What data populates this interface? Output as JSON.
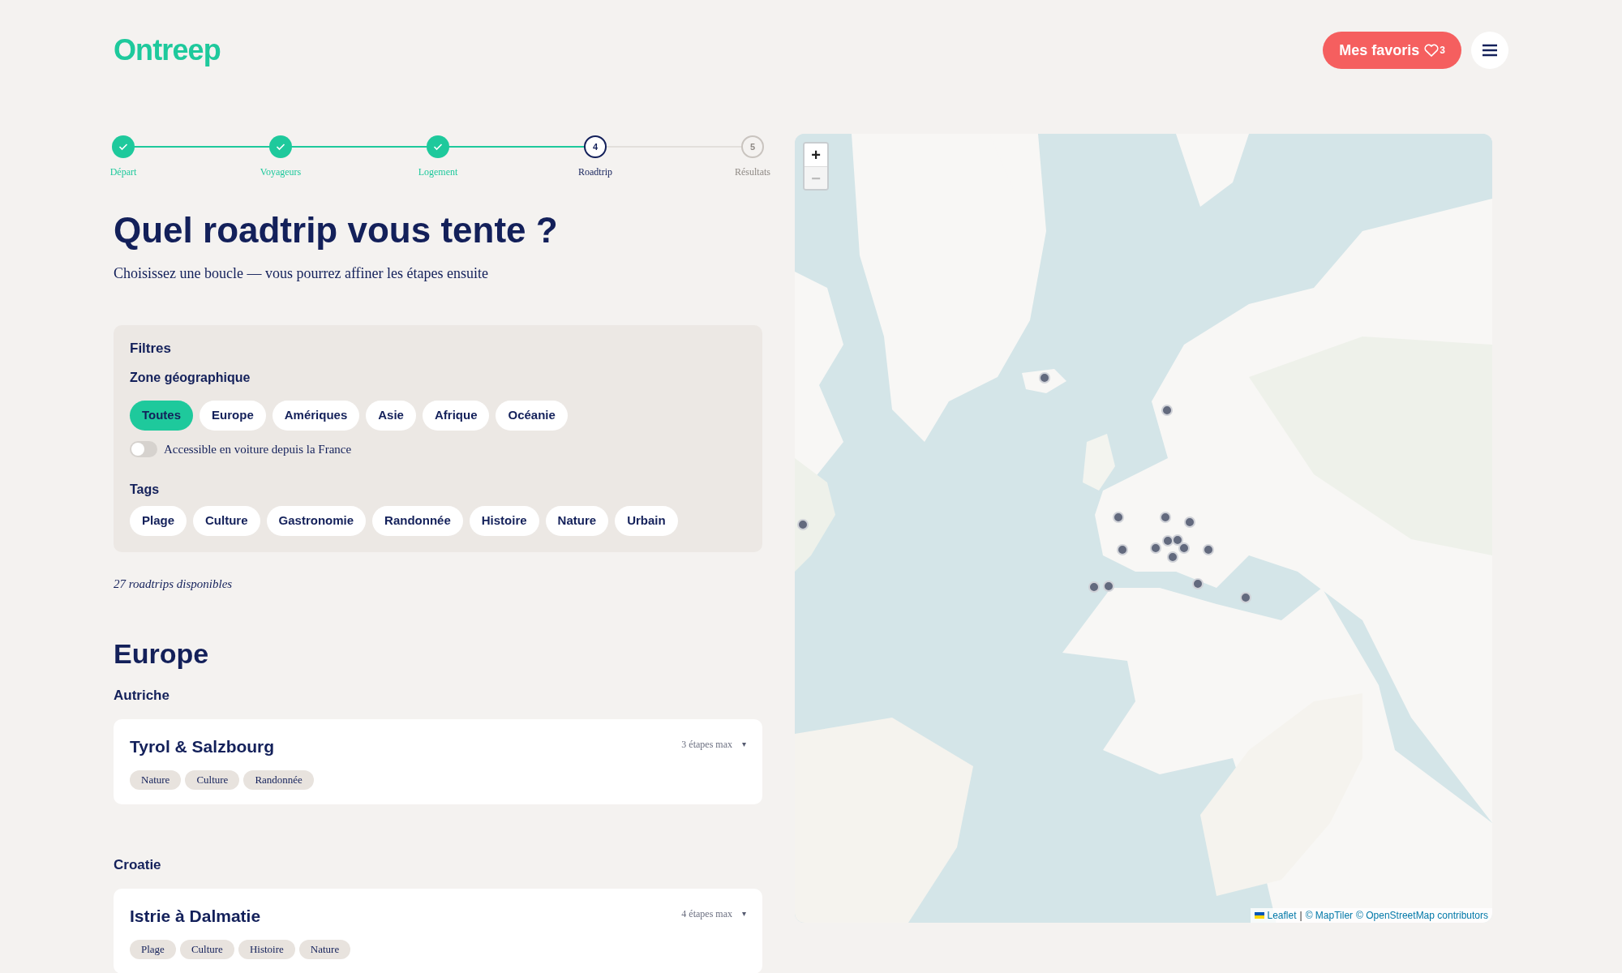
{
  "header": {
    "logo": "Ontreep",
    "favorites": {
      "label": "Mes favoris",
      "count": "3"
    }
  },
  "stepper": [
    {
      "label": "Départ",
      "completed": true,
      "selected": false
    },
    {
      "label": "Voyageurs",
      "completed": true,
      "selected": false
    },
    {
      "label": "Logement",
      "completed": true,
      "selected": false
    },
    {
      "label": "Roadtrip",
      "number": "4",
      "completed": false,
      "selected": true
    },
    {
      "label": "Résultats",
      "number": "5",
      "completed": false,
      "selected": false
    }
  ],
  "title": "Quel roadtrip vous tente ?",
  "subtitle": "Choisissez une boucle — vous pourrez affiner les étapes ensuite",
  "filters": {
    "title": "Filtres",
    "zone_label": "Zone géographique",
    "zones": [
      {
        "label": "Toutes",
        "selected": true
      },
      {
        "label": "Europe",
        "selected": false
      },
      {
        "label": "Amériques",
        "selected": false
      },
      {
        "label": "Asie",
        "selected": false
      },
      {
        "label": "Afrique",
        "selected": false
      },
      {
        "label": "Océanie",
        "selected": false
      }
    ],
    "car_toggle": {
      "label": "Accessible en voiture depuis la France",
      "on": false
    },
    "tags_label": "Tags",
    "tags": [
      {
        "label": "Plage",
        "selected": false
      },
      {
        "label": "Culture",
        "selected": false
      },
      {
        "label": "Gastronomie",
        "selected": false
      },
      {
        "label": "Randonnée",
        "selected": false
      },
      {
        "label": "Histoire",
        "selected": false
      },
      {
        "label": "Nature",
        "selected": false
      },
      {
        "label": "Urbain",
        "selected": false
      }
    ]
  },
  "count": "27 roadtrips disponibles",
  "sections": [
    {
      "title": "Europe",
      "countries": [
        {
          "name": "Autriche",
          "trips": [
            {
              "title": "Tyrol & Salzbourg",
              "stages": "3 étapes max",
              "caret": "▾",
              "tags": [
                "Nature",
                "Culture",
                "Randonnée"
              ]
            }
          ]
        },
        {
          "name": "Croatie",
          "trips": [
            {
              "title": "Istrie à Dalmatie",
              "stages": "4 étapes max",
              "caret": "▾",
              "tags": [
                "Plage",
                "Culture",
                "Histoire",
                "Nature"
              ]
            }
          ]
        }
      ]
    }
  ],
  "map": {
    "kind": "picture",
    "zoom_in": {
      "label": "+",
      "disabled": false
    },
    "zoom_out": {
      "label": "−",
      "disabled": true
    },
    "attribution": [
      {
        "kind": "link",
        "text": "Leaflet"
      },
      {
        "kind": "text",
        "text": "|"
      },
      {
        "kind": "link",
        "text": "© MapTiler"
      },
      {
        "kind": "link",
        "text": "© OpenStreetMap contributors"
      }
    ]
  }
}
